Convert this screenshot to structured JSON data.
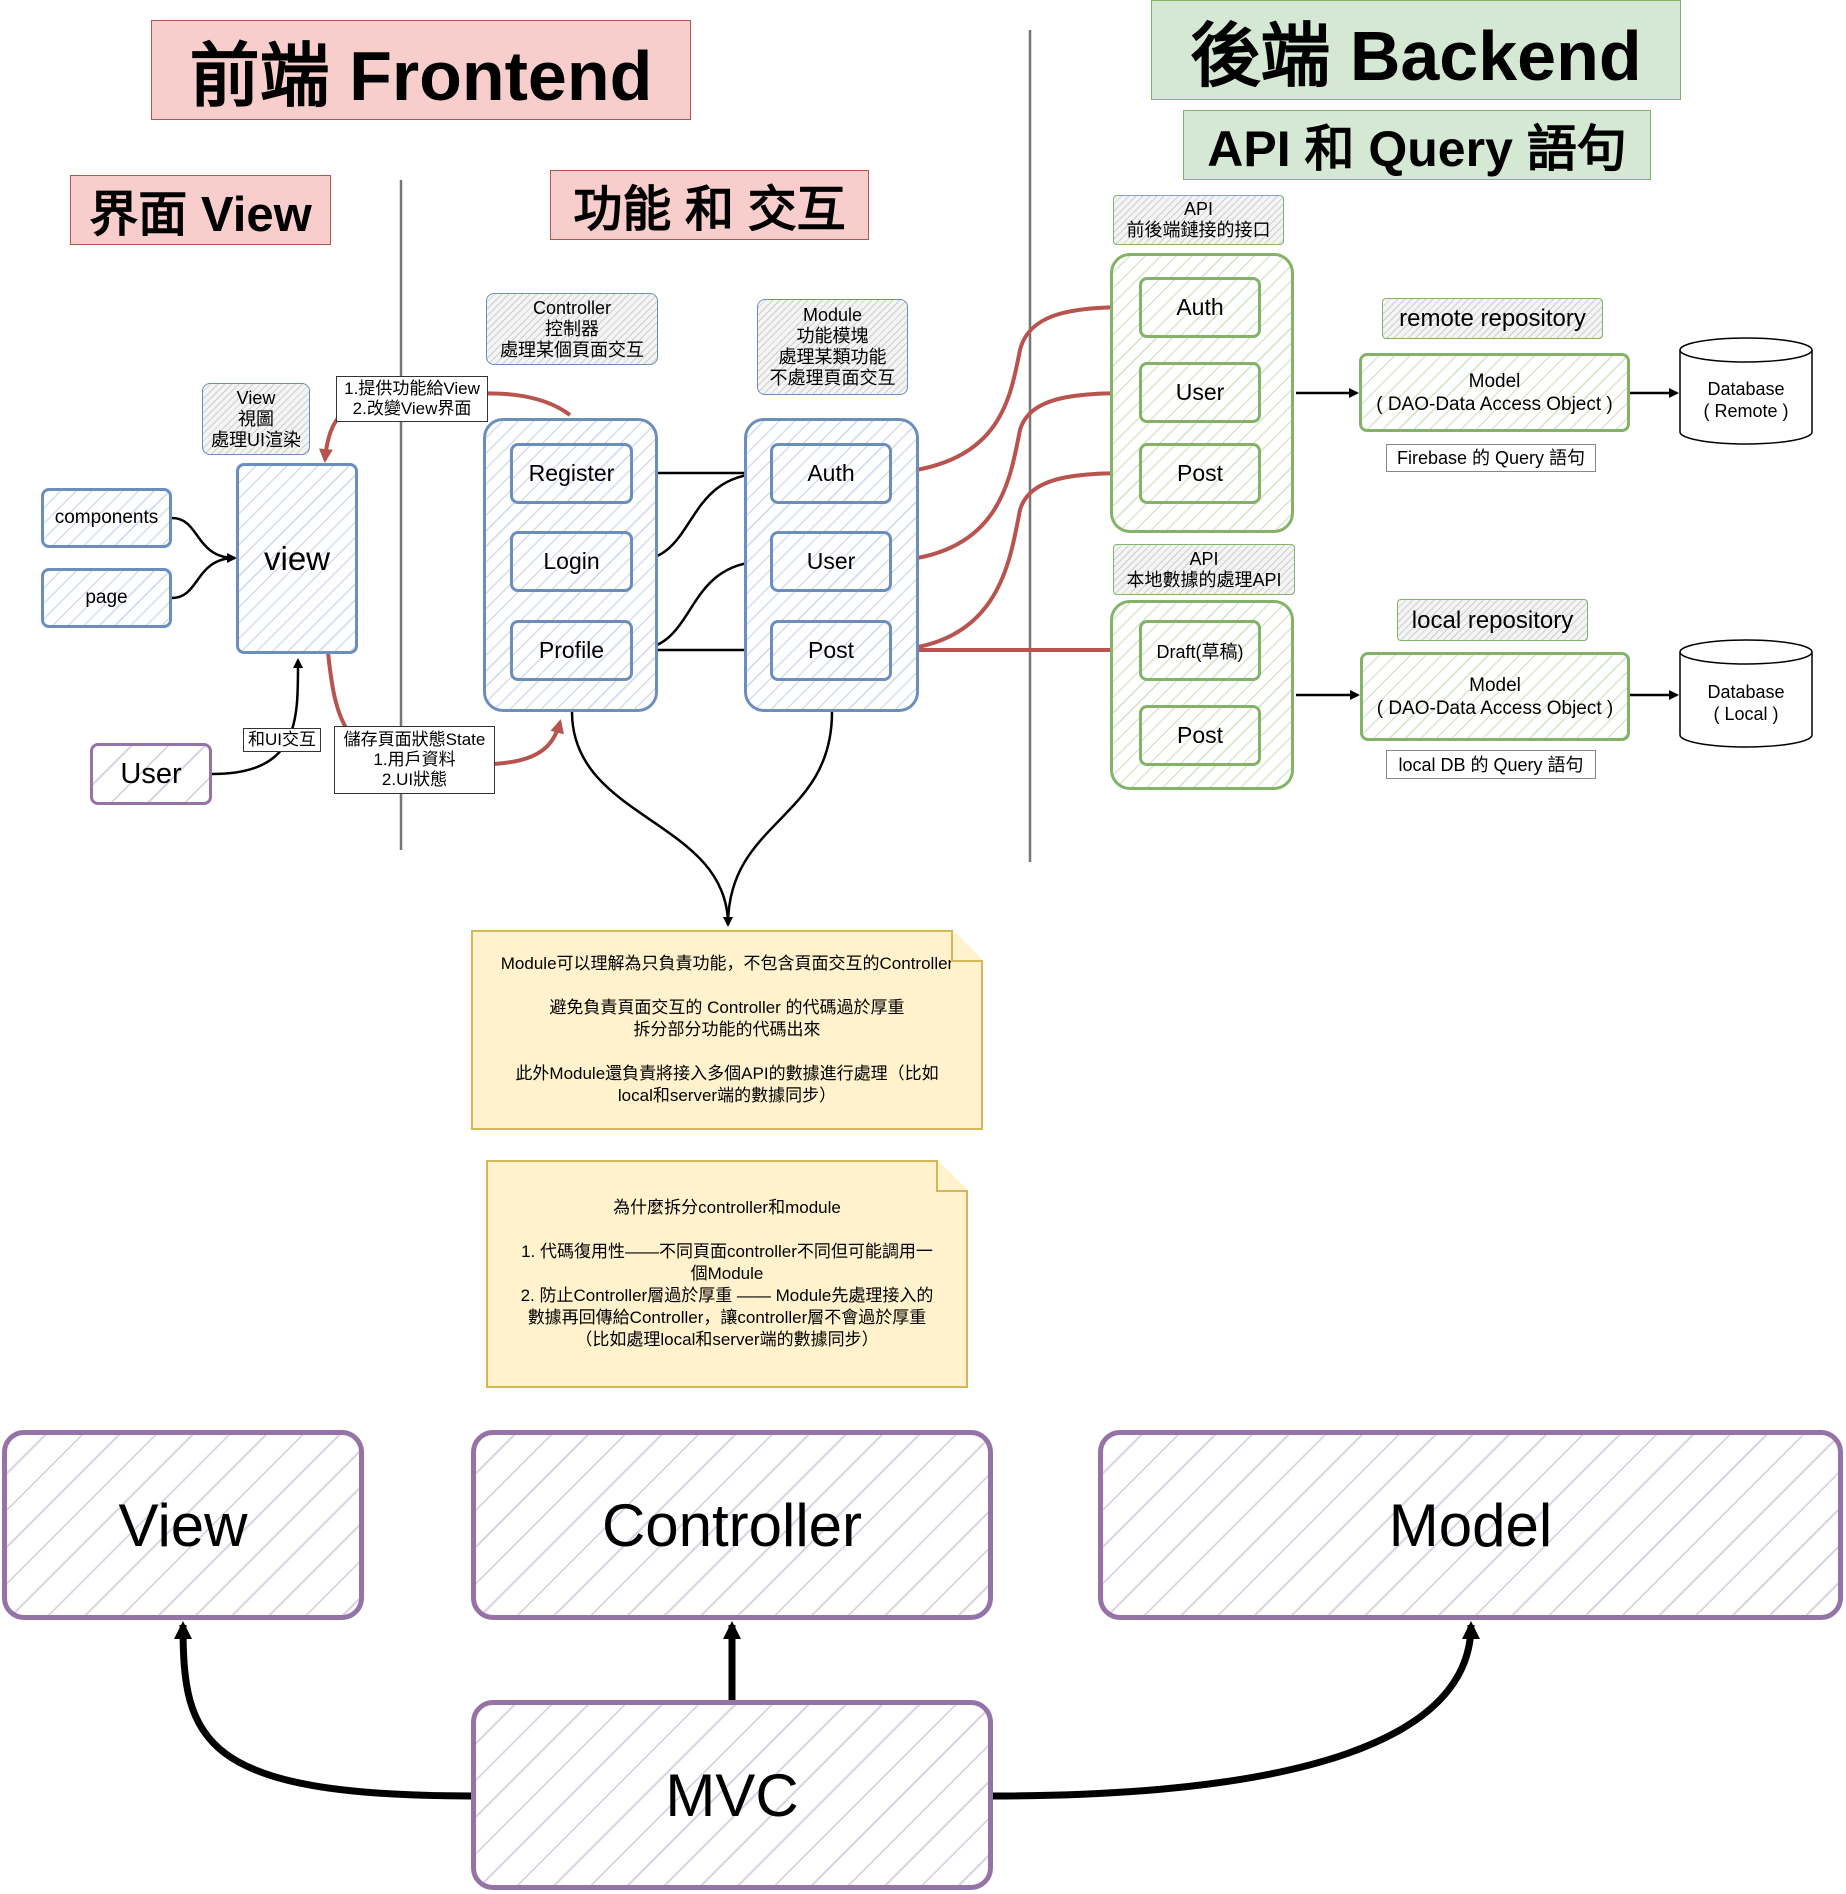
{
  "titles": {
    "frontend": "前端 Frontend",
    "backend": "後端 Backend",
    "backend_sub": "API 和 Query 語句",
    "view_section": "界面 View",
    "function_section": "功能 和 交互"
  },
  "view_area": {
    "label": [
      "View",
      "視圖",
      "處理UI渲染"
    ],
    "view_box": "view",
    "components": "components",
    "page": "page",
    "user": "User",
    "edge_ui_interact": "和UI交互",
    "edge_provide": [
      "1.提供功能給View",
      "2.改變View界面"
    ],
    "edge_store": [
      "儲存頁面狀態State",
      "1.用戶資料",
      "2.UI狀態"
    ]
  },
  "controller_area": {
    "label": [
      "Controller",
      "控制器",
      "處理某個頁面交互"
    ],
    "items": [
      "Register",
      "Login",
      "Profile"
    ]
  },
  "module_area": {
    "label": [
      "Module",
      "功能模塊",
      "處理某類功能",
      "不處理頁面交互"
    ],
    "items": [
      "Auth",
      "User",
      "Post"
    ]
  },
  "api_remote": {
    "label": [
      "API",
      "前後端鏈接的接口"
    ],
    "items": [
      "Auth",
      "User",
      "Post"
    ]
  },
  "api_local": {
    "label": [
      "API",
      "本地數據的處理API"
    ],
    "items": [
      "Draft(草稿)",
      "Post"
    ]
  },
  "remote_repo": {
    "label": "remote repository",
    "model": [
      "Model",
      "( DAO-Data Access Object )"
    ],
    "query": "Firebase 的 Query 語句",
    "database": [
      "Database",
      "( Remote )"
    ]
  },
  "local_repo": {
    "label": "local repository",
    "model": [
      "Model",
      "( DAO-Data Access Object )"
    ],
    "query": "local DB 的 Query 語句",
    "database": [
      "Database",
      "( Local )"
    ]
  },
  "notes": {
    "note1": [
      "Module可以理解為只負責功能，不包含頁面交互的Controller",
      "",
      "避免負責頁面交互的 Controller 的代碼過於厚重",
      "拆分部分功能的代碼出來",
      "",
      "此外Module還負責將接入多個API的數據進行處理（比如",
      "local和server端的數據同步）"
    ],
    "note2": [
      "為什麼拆分controller和module",
      "",
      "1. 代碼復用性——不同頁面controller不同但可能調用一",
      "個Module",
      "2. 防止Controller層過於厚重 —— Module先處理接入的",
      "數據再回傳給Controller，讓controller層不會過於厚重",
      "（比如處理local和server端的數據同步）"
    ]
  },
  "mvc": {
    "view": "View",
    "controller": "Controller",
    "model": "Model",
    "root": "MVC"
  },
  "colors": {
    "red_fill": "#f8cecc",
    "red_stroke": "#b85450",
    "green_fill": "#d5e8d4",
    "green_stroke": "#82b366",
    "blue_stroke": "#6c8ebf",
    "purple_stroke": "#9673a6",
    "note_fill": "#fff2cc",
    "note_stroke": "#d6b656"
  }
}
